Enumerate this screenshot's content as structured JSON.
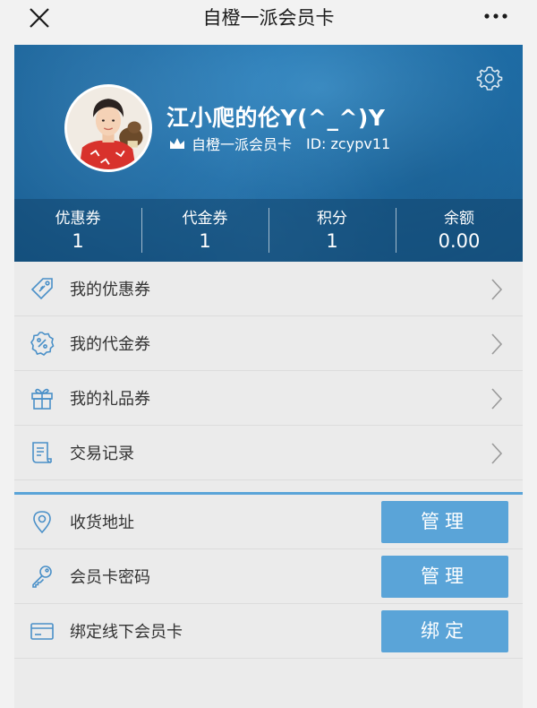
{
  "header": {
    "title": "自橙一派会员卡",
    "close_icon": "close-icon",
    "more_icon": "more-dots-icon"
  },
  "card": {
    "username": "江小爬的伦Y(^_^)Y",
    "card_name": "自橙一派会员卡",
    "member_id": "ID: zcypv11",
    "settings_icon": "gear-icon",
    "crown_icon": "crown-icon",
    "stats": [
      {
        "label": "优惠券",
        "value": "1"
      },
      {
        "label": "代金券",
        "value": "1"
      },
      {
        "label": "积分",
        "value": "1"
      },
      {
        "label": "余额",
        "value": "0.00"
      }
    ]
  },
  "menu": [
    {
      "label": "我的优惠券",
      "icon": "coupon-tag-icon"
    },
    {
      "label": "我的代金券",
      "icon": "percent-badge-icon"
    },
    {
      "label": "我的礼品券",
      "icon": "gift-icon"
    },
    {
      "label": "交易记录",
      "icon": "receipt-icon"
    }
  ],
  "actions": [
    {
      "label": "收货地址",
      "icon": "location-pin-icon",
      "button": "管理"
    },
    {
      "label": "会员卡密码",
      "icon": "key-icon",
      "button": "管理"
    },
    {
      "label": "绑定线下会员卡",
      "icon": "card-icon",
      "button": "绑定"
    }
  ],
  "colors": {
    "card_blue": "#1f6ea8",
    "button_blue": "#5aa4d8",
    "icon_blue": "#4a90c8"
  }
}
